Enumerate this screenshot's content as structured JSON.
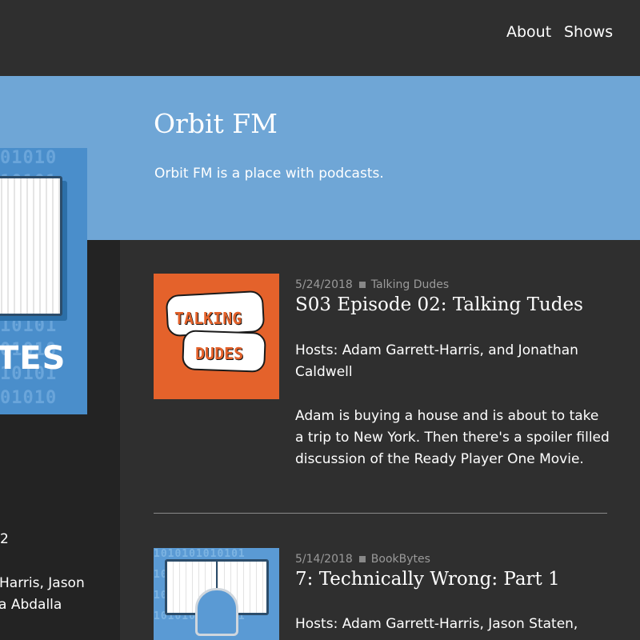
{
  "nav": {
    "about": "About",
    "shows": "Shows"
  },
  "site": {
    "title": "Orbit FM",
    "description": "Orbit FM is a place with podcasts."
  },
  "sidebar": {
    "art_tes": "TES",
    "binary_rows": [
      "01010",
      "10101",
      "01010",
      "10101",
      "01010",
      "10101",
      "01010",
      "10101",
      "01010",
      "10101",
      "01010"
    ],
    "line1": "2",
    "line2": "Harris, Jason",
    "line3": "a Abdalla"
  },
  "episodes": [
    {
      "date": "5/24/2018",
      "show": "Talking Dudes",
      "title": "S03 Episode 02: Talking Tudes",
      "hosts": "Hosts: Adam Garrett-Harris, and Jonathan Caldwell",
      "description": "Adam is buying a house and is about to take a trip to New York. Then there's a spoiler filled discussion of the Ready Player One Movie.",
      "art": {
        "word1": "TALKING",
        "word2": "DUDES",
        "bg_color": "#e4622b"
      }
    },
    {
      "date": "5/14/2018",
      "show": "BookBytes",
      "title": "7: Technically Wrong: Part 1",
      "hosts": "Hosts: Adam Garrett-Harris, Jason Staten,",
      "art": {
        "binary": "1010101010101",
        "bg_color": "#5a9ad4"
      }
    }
  ],
  "colors": {
    "hero": "#6fa6d6",
    "background": "#2f2f2f",
    "accent": "#e4622b"
  }
}
